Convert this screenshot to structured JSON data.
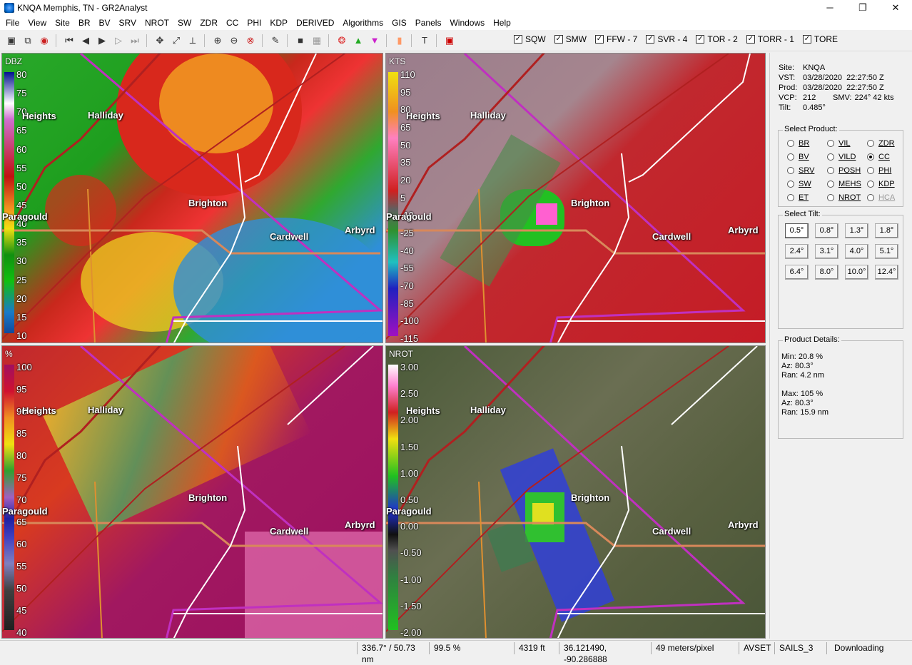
{
  "window": {
    "title": "KNQA Memphis, TN - GR2Analyst",
    "minimize": "─",
    "maximize": "❐",
    "close": "✕"
  },
  "menu": [
    "File",
    "View",
    "Site",
    "BR",
    "BV",
    "SRV",
    "NROT",
    "SW",
    "ZDR",
    "CC",
    "PHI",
    "KDP",
    "DERIVED",
    "Algorithms",
    "GIS",
    "Panels",
    "Windows",
    "Help"
  ],
  "warnings": [
    {
      "label": "SQW",
      "checked": true
    },
    {
      "label": "SMW",
      "checked": true
    },
    {
      "label": "FFW - 7",
      "checked": true
    },
    {
      "label": "SVR - 4",
      "checked": true
    },
    {
      "label": "TOR - 2",
      "checked": true
    },
    {
      "label": "TORR - 1",
      "checked": true
    },
    {
      "label": "TORE",
      "checked": true
    }
  ],
  "panels": {
    "p1": {
      "unit": "DBZ",
      "scale": [
        "80",
        "75",
        "70",
        "65",
        "60",
        "55",
        "50",
        "45",
        "40",
        "35",
        "30",
        "25",
        "20",
        "15",
        "10"
      ]
    },
    "p2": {
      "unit": "KTS",
      "scale": [
        "110",
        "95",
        "80",
        "65",
        "50",
        "35",
        "20",
        "5",
        "-10",
        "-25",
        "-40",
        "-55",
        "-70",
        "-85",
        "-100",
        "-115"
      ]
    },
    "p3": {
      "unit": "%",
      "scale": [
        "100",
        "95",
        "90",
        "85",
        "80",
        "75",
        "70",
        "65",
        "60",
        "55",
        "50",
        "45",
        "40"
      ]
    },
    "p4": {
      "unit": "NROT",
      "scale": [
        "3.00",
        "2.50",
        "2.00",
        "1.50",
        "1.00",
        "0.50",
        "0.00",
        "-0.50",
        "-1.00",
        "-1.50",
        "-2.00"
      ]
    }
  },
  "cities": {
    "heights": "Heights",
    "halliday": "Halliday",
    "brighton": "Brighton",
    "cardwell": "Cardwell",
    "arbyrd": "Arbyrd",
    "paragould": "Paragould"
  },
  "site": {
    "site_label": "Site:",
    "site": "KNQA",
    "vst_label": "VST:",
    "vst": "03/28/2020  22:27:50 Z",
    "prod_label": "Prod:",
    "prod": "03/28/2020  22:27:50 Z",
    "vcp_label": "VCP:",
    "vcp": "212",
    "smv_label": "SMV:",
    "smv": "224° 42 kts",
    "tilt_label": "Tilt:",
    "tilt": "0.485°"
  },
  "select_product": {
    "title": "Select Product:",
    "items": [
      {
        "label": "BR",
        "checked": false,
        "enabled": true
      },
      {
        "label": "VIL",
        "checked": false,
        "enabled": true
      },
      {
        "label": "ZDR",
        "checked": false,
        "enabled": true
      },
      {
        "label": "BV",
        "checked": false,
        "enabled": true
      },
      {
        "label": "VILD",
        "checked": false,
        "enabled": true
      },
      {
        "label": "CC",
        "checked": true,
        "enabled": true
      },
      {
        "label": "SRV",
        "checked": false,
        "enabled": true
      },
      {
        "label": "POSH",
        "checked": false,
        "enabled": true
      },
      {
        "label": "PHI",
        "checked": false,
        "enabled": true
      },
      {
        "label": "SW",
        "checked": false,
        "enabled": true
      },
      {
        "label": "MEHS",
        "checked": false,
        "enabled": true
      },
      {
        "label": "KDP",
        "checked": false,
        "enabled": true
      },
      {
        "label": "ET",
        "checked": false,
        "enabled": true
      },
      {
        "label": "NROT",
        "checked": false,
        "enabled": true
      },
      {
        "label": "HCA",
        "checked": false,
        "enabled": false
      }
    ]
  },
  "select_tilt": {
    "title": "Select Tilt:",
    "items": [
      "0.5°",
      "0.8°",
      "1.3°",
      "1.8°",
      "2.4°",
      "3.1°",
      "4.0°",
      "5.1°",
      "6.4°",
      "8.0°",
      "10.0°",
      "12.4°"
    ],
    "selected": "0.5°"
  },
  "product_details": {
    "title": "Product Details:",
    "min_label": "Min:",
    "min": "20.8 %",
    "min_az_label": "Az:",
    "min_az": "80.3°",
    "min_ran_label": "Ran:",
    "min_ran": "4.2 nm",
    "max_label": "Max:",
    "max": "105 %",
    "max_az_label": "Az:",
    "max_az": "80.3°",
    "max_ran_label": "Ran:",
    "max_ran": "15.9 nm"
  },
  "status": {
    "azran": "336.7° / 50.73 nm",
    "value": "99.5 %",
    "height": "4319 ft",
    "latlon": "36.121490, -90.286888",
    "res": "49 meters/pixel",
    "avset": "AVSET",
    "sails": "SAILS_3",
    "download": "Downloading"
  },
  "colors": {
    "warning_polygon": "#c030c0",
    "road": "#b02020",
    "highway": "#e08040",
    "county": "#ffffff"
  }
}
